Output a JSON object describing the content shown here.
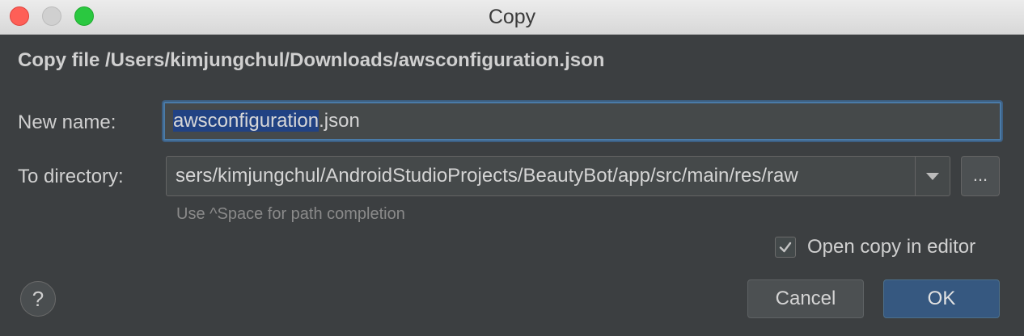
{
  "window": {
    "title": "Copy"
  },
  "dialog": {
    "header": "Copy file /Users/kimjungchul/Downloads/awsconfiguration.json",
    "new_name_label": "New name:",
    "new_name_selected": "awsconfiguration",
    "new_name_rest": ".json",
    "to_directory_label": "To directory:",
    "to_directory_value": "sers/kimjungchul/AndroidStudioProjects/BeautyBot/app/src/main/res/raw",
    "browse_label": "...",
    "hint": "Use ^Space for path completion",
    "open_in_editor_label": "Open copy in editor",
    "open_in_editor_checked": true,
    "help_label": "?",
    "cancel_label": "Cancel",
    "ok_label": "OK"
  },
  "colors": {
    "background": "#3c3f41",
    "selection": "#214283",
    "focus_border": "#4a7ba8",
    "ok_button": "#365880"
  },
  "icons": {
    "close": "close-traffic-light",
    "minimize": "minimize-traffic-light",
    "maximize": "maximize-traffic-light",
    "dropdown": "chevron-down-icon",
    "checkbox": "checkmark-icon",
    "help": "question-mark-icon"
  }
}
